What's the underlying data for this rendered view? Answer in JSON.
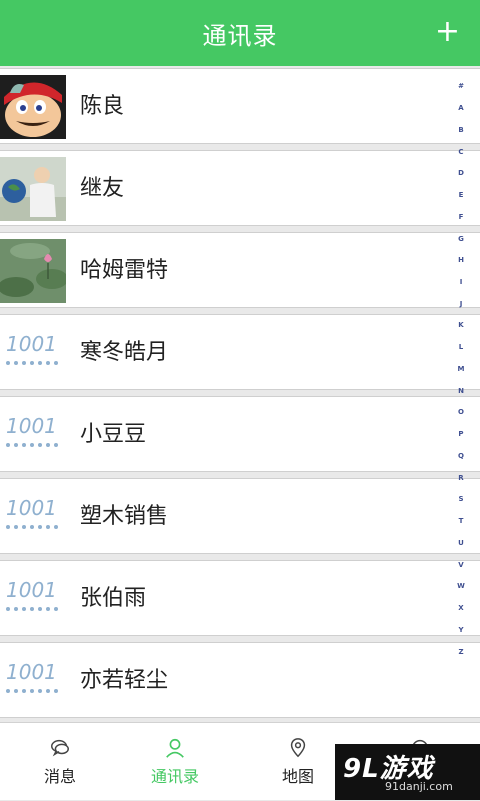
{
  "header": {
    "title": "通讯录",
    "add_icon": "plus-icon",
    "bg": "#45c863"
  },
  "contacts": [
    {
      "name": "陈良",
      "avatar": "photo-mario"
    },
    {
      "name": "继友",
      "avatar": "photo-boy-globe"
    },
    {
      "name": "哈姆雷特",
      "avatar": "photo-lotus"
    },
    {
      "name": "寒冬皓月",
      "avatar": "default-1001"
    },
    {
      "name": "小豆豆",
      "avatar": "default-1001"
    },
    {
      "name": "塑木销售",
      "avatar": "default-1001"
    },
    {
      "name": "张伯雨",
      "avatar": "default-1001"
    },
    {
      "name": "亦若轻尘",
      "avatar": "default-1001"
    }
  ],
  "default_avatar_text": "1001",
  "index_letters": [
    "#",
    "A",
    "B",
    "C",
    "D",
    "E",
    "F",
    "G",
    "H",
    "I",
    "J",
    "K",
    "L",
    "M",
    "N",
    "O",
    "P",
    "Q",
    "R",
    "S",
    "T",
    "U",
    "V",
    "W",
    "X",
    "Y",
    "Z"
  ],
  "tabs": [
    {
      "label": "消息",
      "icon": "chat-bubble-icon",
      "active": false
    },
    {
      "label": "通讯录",
      "icon": "person-icon",
      "active": true
    },
    {
      "label": "地图",
      "icon": "map-pin-icon",
      "active": false
    },
    {
      "label": "",
      "icon": "settings-icon",
      "active": false
    }
  ],
  "watermark": {
    "logo": "9L游戏",
    "site": "91danji.com"
  }
}
